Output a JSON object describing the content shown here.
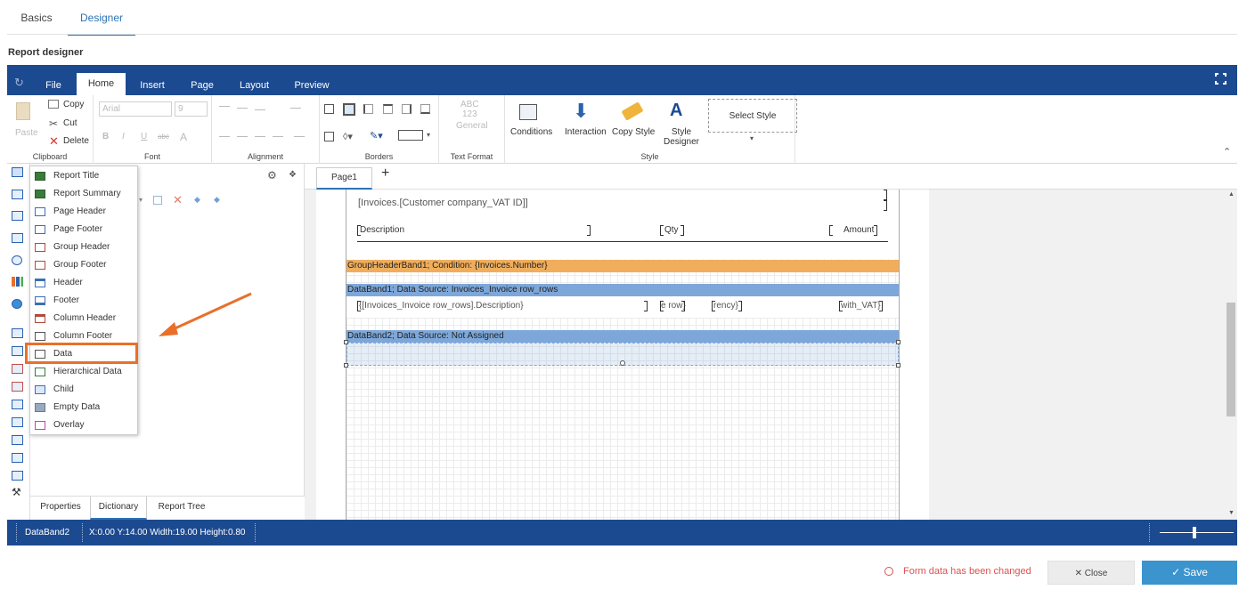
{
  "page_tabs": [
    "Basics",
    "Designer"
  ],
  "section_title": "Report designer",
  "menu_tabs": [
    "File",
    "Home",
    "Insert",
    "Page",
    "Layout",
    "Preview"
  ],
  "ribbon": {
    "clipboard": {
      "paste": "Paste",
      "copy": "Copy",
      "cut": "Cut",
      "delete": "Delete",
      "label": "Clipboard"
    },
    "font": {
      "family": "Arial",
      "size": "9",
      "label": "Font",
      "bold": "B",
      "italic": "I",
      "underline": "U",
      "strike": "abc",
      "color": "A"
    },
    "alignment": {
      "label": "Alignment"
    },
    "borders": {
      "label": "Borders"
    },
    "text_format": {
      "abc": "ABC",
      "num": "123",
      "general": "General",
      "label": "Text Format"
    },
    "style": {
      "conditions": "Conditions",
      "interaction": "Interaction",
      "copy_style": "Copy Style",
      "style_designer": "Style Designer",
      "select_style": "Select Style",
      "label": "Style"
    }
  },
  "bands_menu": [
    "Report Title",
    "Report Summary",
    "Page Header",
    "Page Footer",
    "Group Header",
    "Group Footer",
    "Header",
    "Footer",
    "Column Header",
    "Column Footer",
    "Data",
    "Hierarchical Data",
    "Child",
    "Empty Data",
    "Overlay"
  ],
  "left_panel_tabs": [
    "Properties",
    "Dictionary",
    "Report Tree"
  ],
  "page_tab": "Page1",
  "page_add": "+",
  "report": {
    "vat_field": "[Invoices.[Customer company_VAT ID]]",
    "col_description": "Description",
    "col_qty": "Qty",
    "col_amount": "Amount",
    "group_header": "GroupHeaderBand1; Condition: {Invoices.Number}",
    "databand1": "DataBand1; Data Source: Invoices_Invoice row_rows",
    "field_description": "{[Invoices_Invoice row_rows].Description}",
    "field_row": "e row}",
    "field_currency": "rency}",
    "field_vat": "with_VAT}",
    "databand2": "DataBand2; Data Source: Not Assigned"
  },
  "status": {
    "component": "DataBand2",
    "geometry": "X:0.00 Y:14.00 Width:19.00 Height:0.80"
  },
  "footer": {
    "changed": "Form data has been changed",
    "close": "Close",
    "save": "Save"
  },
  "colors": {
    "primary": "#1c4a90",
    "accent": "#2a73b5",
    "highlight": "#e8702a",
    "group_header": "#f0ae5c",
    "data_band": "#7da7d9",
    "save": "#3b94ce"
  }
}
